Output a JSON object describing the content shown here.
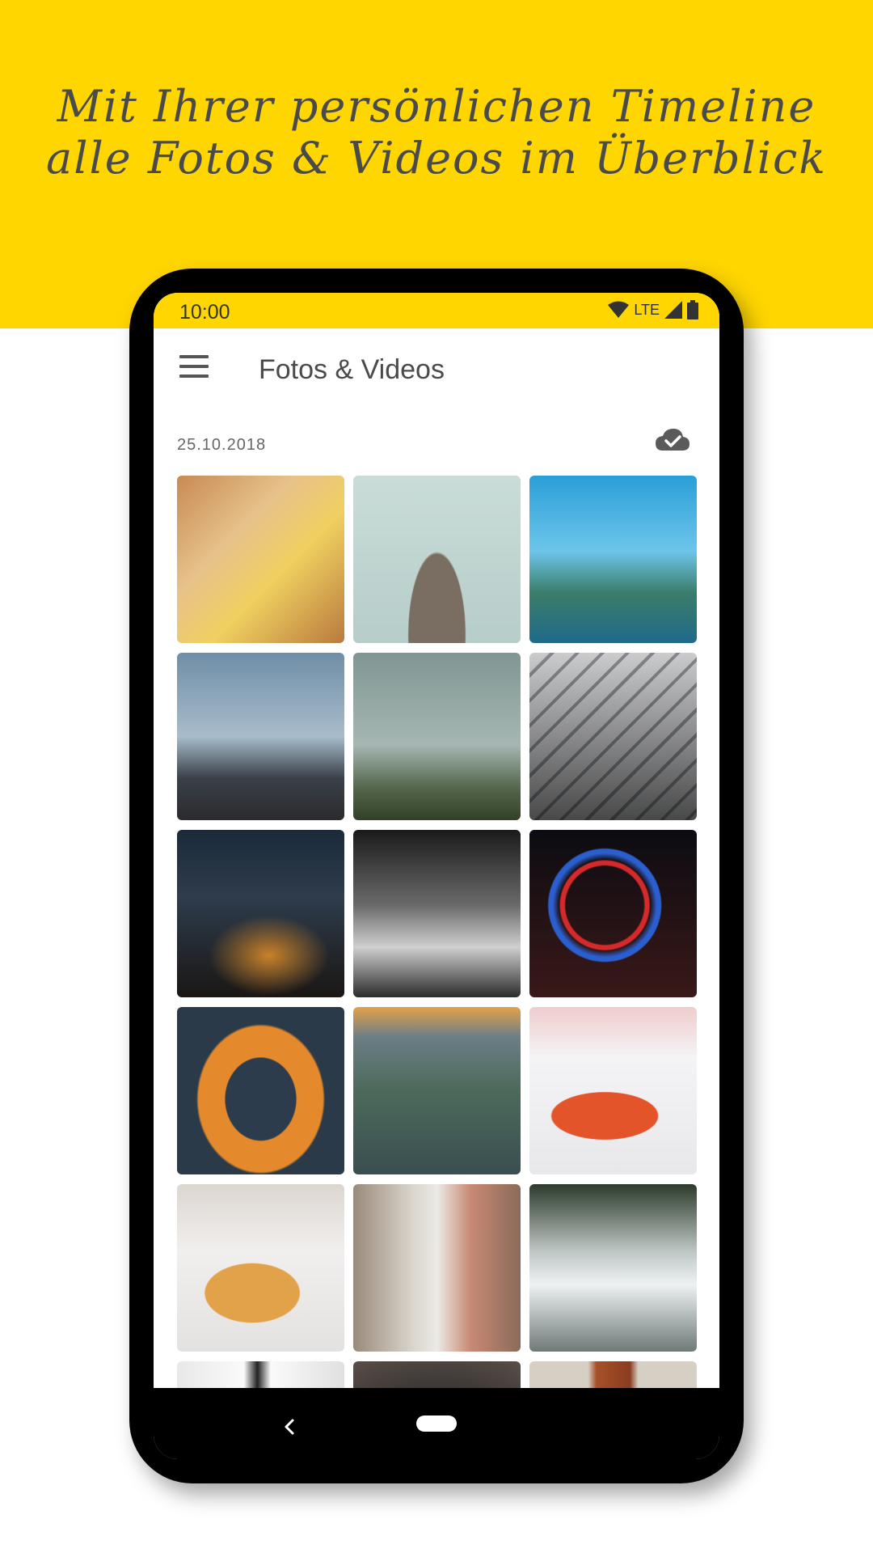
{
  "headline": {
    "line1": "Mit Ihrer persönlichen Timeline",
    "line2": "alle Fotos & Videos im Überblick"
  },
  "status_bar": {
    "time": "10:00",
    "network": "LTE",
    "icons": [
      "wifi-icon",
      "signal-icon",
      "battery-icon"
    ]
  },
  "app_bar": {
    "menu_icon": "menu-icon",
    "title": "Fotos & Videos"
  },
  "section": {
    "date": "25.10.2018",
    "sync_icon": "cloud-check-icon"
  },
  "photos": [
    "beer-mug",
    "town-hall-tower",
    "olympic-tower",
    "man-on-bridge",
    "foggy-skyline",
    "stadium-facade",
    "city-night-aerial",
    "tram-street-bw",
    "ferris-wheel",
    "orange-subway-station",
    "stadium-aerial-sunset",
    "orange-classic-car",
    "isetta-car",
    "pedestrian-street",
    "river-surfer",
    "white-interior",
    "lens-closeup",
    "wooden-door"
  ],
  "nav_bar": {
    "back_icon": "back-icon",
    "home_icon": "home-pill-icon"
  },
  "colors": {
    "accent": "#FFD600",
    "text": "#4a4a4a",
    "background": "#ffffff"
  }
}
